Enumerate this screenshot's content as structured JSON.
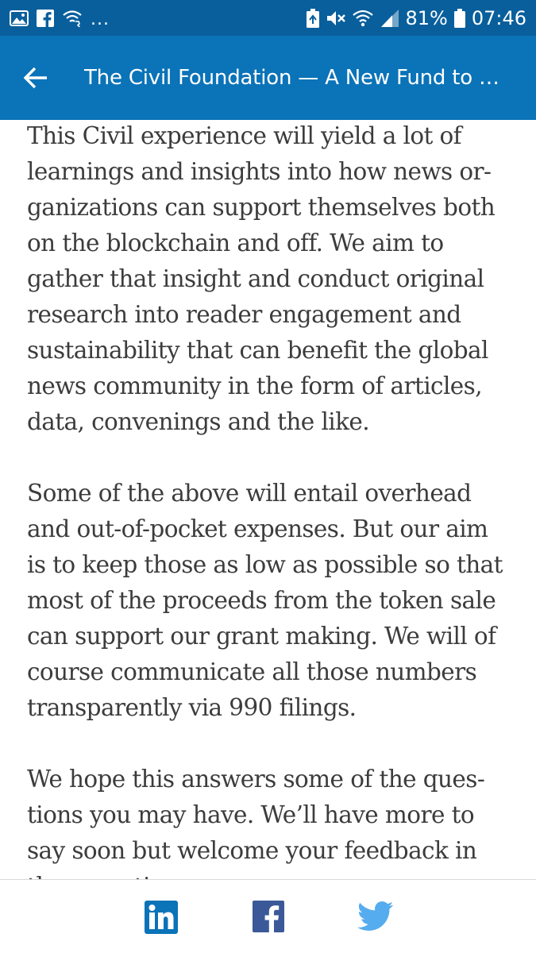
{
  "status_bar": {
    "left_icons": [
      "gallery-icon",
      "facebook-notification-icon",
      "wifi-calling-icon"
    ],
    "overflow_indicator": "...",
    "right_icons": [
      "battery-saver-icon",
      "mute-icon",
      "wifi-icon",
      "cell-signal-icon"
    ],
    "battery_percent": "81%",
    "time": "07:46"
  },
  "app_bar": {
    "back_icon": "arrow-left-icon",
    "title": "The Civil Foundation — A New Fund to S..."
  },
  "article": {
    "paragraphs": [
      {
        "lines": [
          "This Civil experience will yield a lot of",
          "learnings and insights into how news or-",
          "ganizations can support themselves both",
          "on the blockchain and off. We aim to",
          "gather that insight and conduct original",
          "research into reader engagement and",
          "sustainability that can benefit the global",
          "news community in the form of articles,",
          "data, convenings and the like."
        ]
      },
      {
        "lines": [
          "Some of the above will entail overhead",
          "and out-of-pocket expenses. But our aim",
          "is to keep those as low as possible so that",
          "most of the proceeds from the token sale",
          "can support our grant making. We will of",
          "course communicate all those numbers",
          "transparently via 990 filings."
        ]
      },
      {
        "lines": [
          "We hope this answers some of the ques-",
          "tions you may have. We’ll have more to",
          "say soon but welcome your feedback in",
          "the meantime."
        ]
      }
    ]
  },
  "share_bar": {
    "buttons": [
      "linkedin-icon",
      "facebook-icon",
      "twitter-icon"
    ]
  },
  "colors": {
    "status_bar": "#085f9c",
    "app_bar": "#0b73b8",
    "body_text": "#3c3c3c",
    "linkedin": "#0b73b8",
    "facebook": "#3b5998",
    "twitter": "#55acee"
  }
}
